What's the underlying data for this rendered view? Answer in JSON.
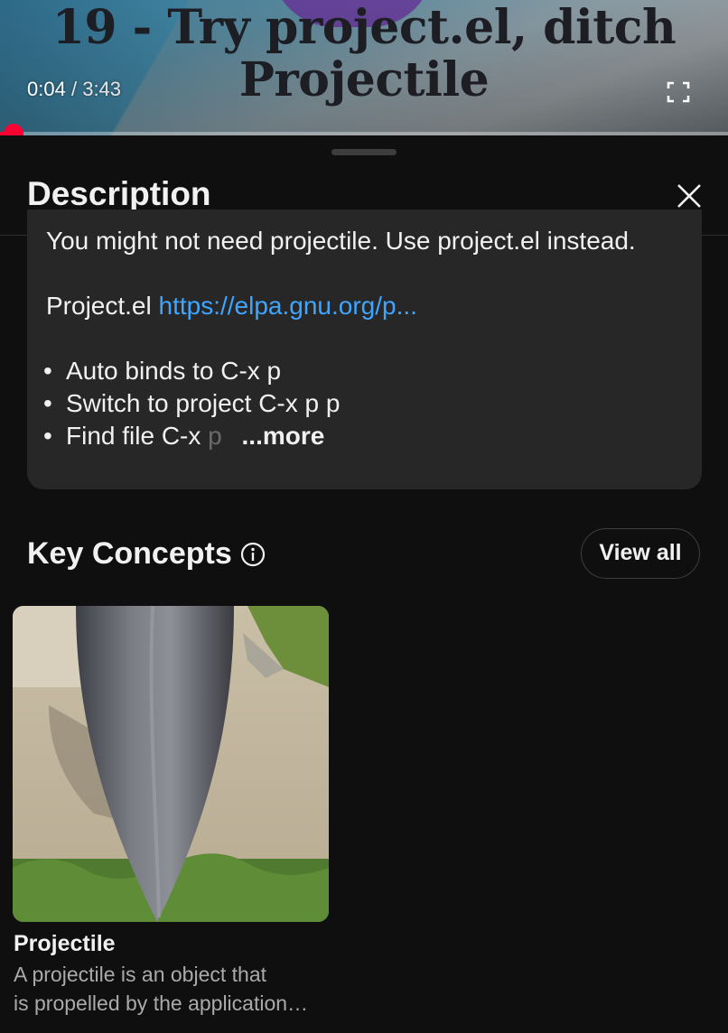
{
  "player": {
    "video_title_line1": "19 - Try project.el, ditch",
    "video_title_line2": "Projectile",
    "current_time": "0:04",
    "separator": "/",
    "duration": "3:43",
    "progress_fraction": 0.018,
    "progress_color": "#ff0033"
  },
  "sheet": {
    "title": "Description"
  },
  "description": {
    "line1": "You might not need projectile. Use project.el instead.",
    "link_prefix": "Project.el",
    "link_text": "https://elpa.gnu.org/p...",
    "bullets": [
      "Auto binds to C-x p",
      "Switch to project C-x p p",
      "Find file C-x"
    ],
    "faded_text": "p",
    "more_label": "...more",
    "link_color": "#3ea6ff"
  },
  "key_concepts": {
    "heading": "Key Concepts",
    "view_all_label": "View all",
    "items": [
      {
        "title": "Projectile",
        "description_line1": "A projectile is an object that",
        "description_line2": "is propelled by the application…",
        "icon": "projectile-photo"
      }
    ]
  },
  "icons": {
    "fullscreen": "fullscreen-icon",
    "close": "close-icon",
    "info": "info-icon"
  }
}
